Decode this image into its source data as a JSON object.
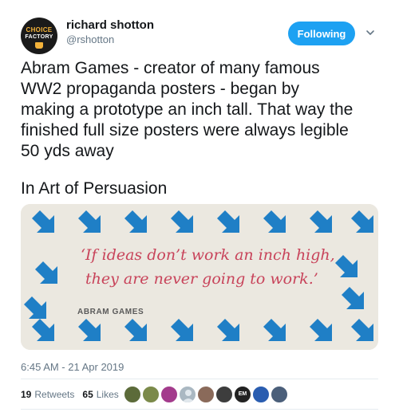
{
  "user": {
    "display_name": "richard shotton",
    "handle": "@rshotton",
    "avatar_text": [
      "CHOICE",
      "FACTORY"
    ]
  },
  "follow_button": {
    "label": "Following"
  },
  "tweet": {
    "lines": [
      "Abram Games - creator of many famous",
      "WW2 propaganda posters - began by",
      "making a prototype an inch tall. That way the",
      "finished full size posters were always legible",
      "50 yds away"
    ],
    "line2": "In Art of Persuasion"
  },
  "media": {
    "quote_line1": "‘If ideas don’t work an inch high,",
    "quote_line2": "they are never going to work.’",
    "attribution": "ABRAM GAMES",
    "arrow_color": "#1f7fc6",
    "quote_color": "#c8435a"
  },
  "timestamp": "6:45 AM - 21 Apr 2019",
  "stats": {
    "retweets_count": "19",
    "retweets_label": "Retweets",
    "likes_count": "65",
    "likes_label": "Likes"
  },
  "likers": [
    {
      "icon": "user-avatar-icon",
      "color": "#5c6b3a"
    },
    {
      "icon": "user-avatar-icon",
      "color": "#7b8a4a"
    },
    {
      "icon": "user-avatar-icon",
      "color": "#a33b8c"
    },
    {
      "icon": "default-avatar-icon",
      "color": "#aab8c2"
    },
    {
      "icon": "user-avatar-icon",
      "color": "#8a6a5a"
    },
    {
      "icon": "user-avatar-icon",
      "color": "#3d3d3d"
    },
    {
      "icon": "user-avatar-icon",
      "color": "#222222",
      "text": "EM"
    },
    {
      "icon": "user-avatar-icon",
      "color": "#2a5db0"
    },
    {
      "icon": "user-avatar-icon",
      "color": "#4b5f7a"
    }
  ]
}
